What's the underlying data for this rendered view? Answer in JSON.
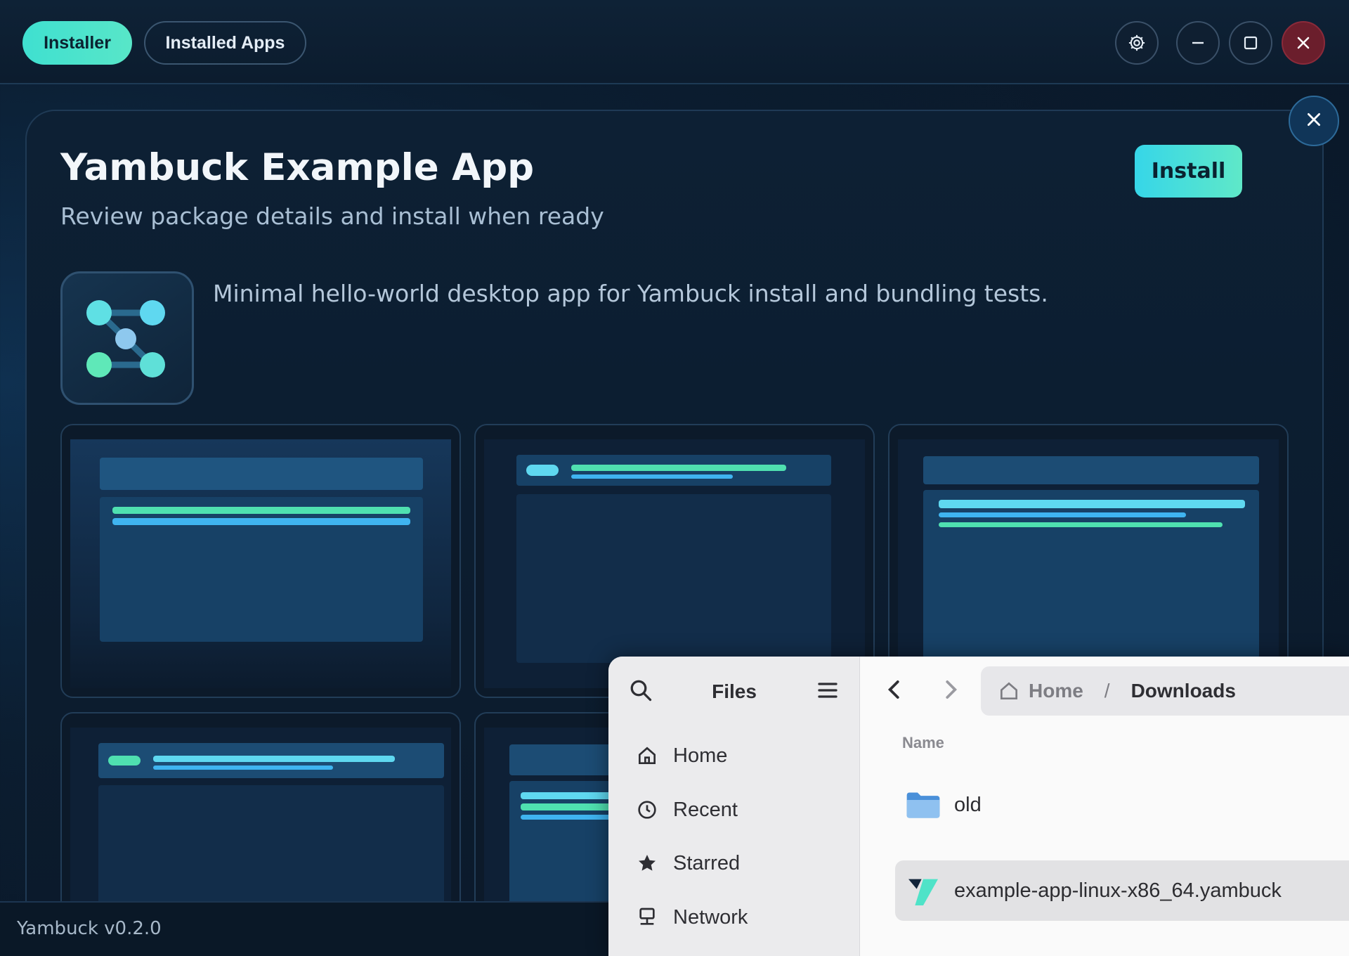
{
  "header": {
    "tabs": [
      {
        "label": "Installer",
        "active": true
      },
      {
        "label": "Installed Apps",
        "active": false
      }
    ],
    "window_buttons": [
      "gear-icon",
      "minimize-icon",
      "maximize-icon",
      "close-icon"
    ]
  },
  "app": {
    "title": "Yambuck Example App",
    "subtitle": "Review package details and install when ready",
    "install_label": "Install",
    "description": "Minimal hello-world desktop app for Yambuck install and bundling tests."
  },
  "footer": {
    "version": "Yambuck v0.2.0"
  },
  "files": {
    "title": "Files",
    "sidebar": [
      {
        "label": "Home",
        "icon": "home-icon"
      },
      {
        "label": "Recent",
        "icon": "clock-icon"
      },
      {
        "label": "Starred",
        "icon": "star-icon"
      },
      {
        "label": "Network",
        "icon": "network-icon"
      }
    ],
    "path": [
      "Home",
      "/",
      "Downloads"
    ],
    "column_header": "Name",
    "items": [
      {
        "name": "old",
        "type": "folder"
      },
      {
        "name": "example-app-linux-x86_64.yambuck",
        "type": "yambuck",
        "selected": true
      }
    ]
  },
  "colors": {
    "accent_teal": "#3fe0d0",
    "accent_cyan": "#36d6e8",
    "background": "#0b1d30",
    "close_red": "#6b1e2c"
  }
}
